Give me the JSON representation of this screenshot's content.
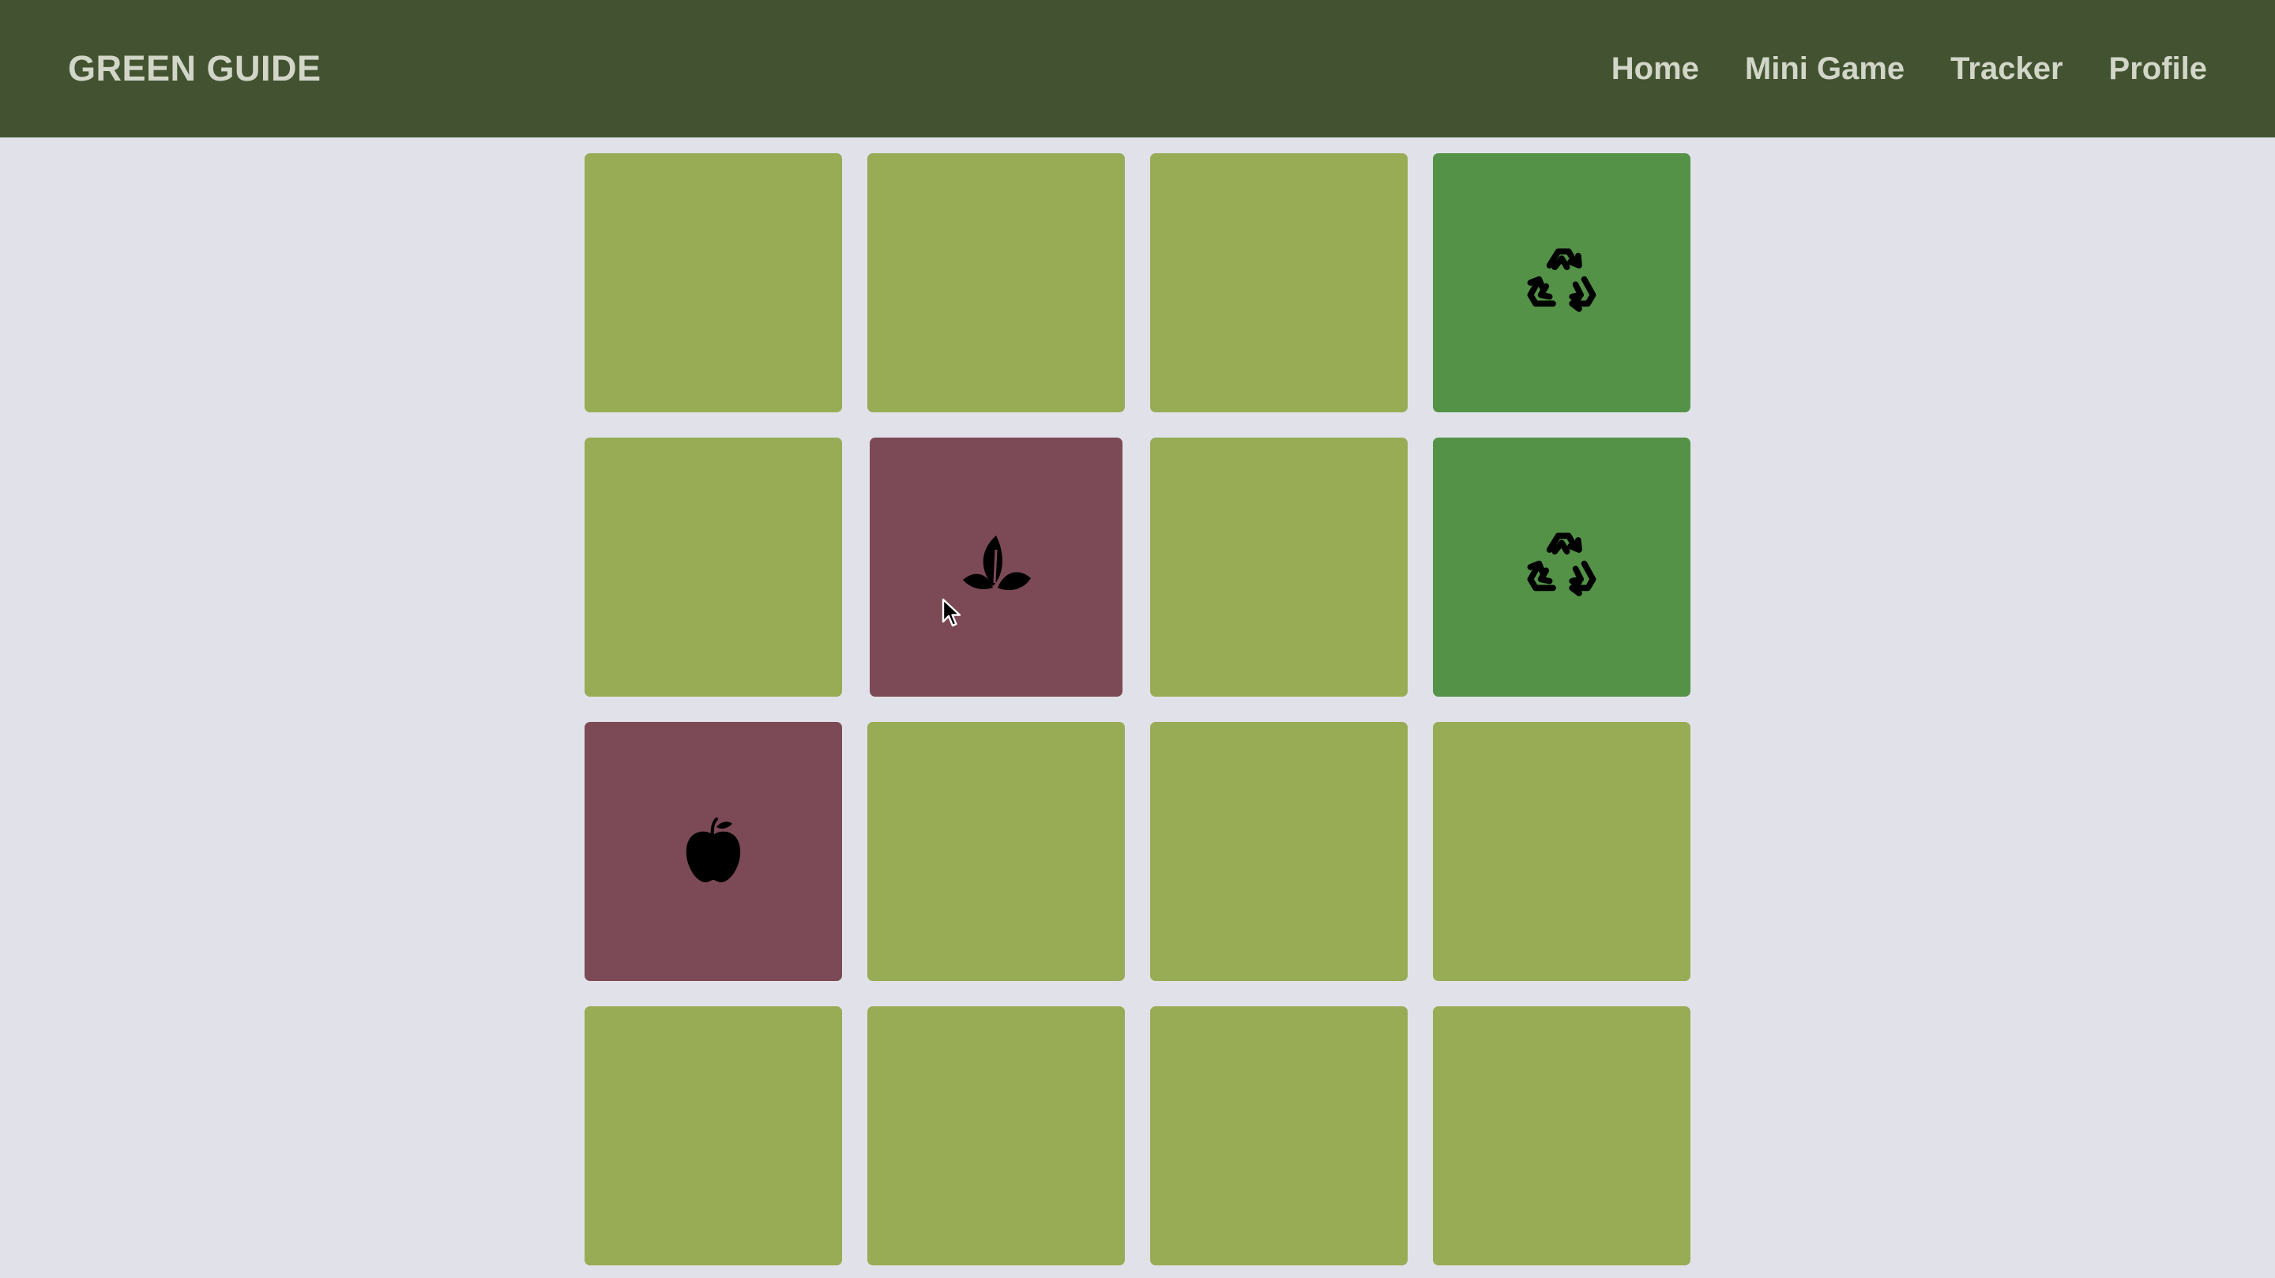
{
  "navbar": {
    "brand": "GREEN GUIDE",
    "links": [
      {
        "label": "Home"
      },
      {
        "label": "Mini Game"
      },
      {
        "label": "Tracker"
      },
      {
        "label": "Profile"
      }
    ]
  },
  "colors": {
    "navbar_bg": "#435331",
    "page_bg": "#e1e2e9",
    "card_hidden": "#98ab55",
    "card_matched": "#549248",
    "card_flipped": "#7c4a56"
  },
  "board": {
    "rows": 4,
    "cols": 4,
    "cards": [
      {
        "state": "hidden",
        "icon": null
      },
      {
        "state": "hidden",
        "icon": null
      },
      {
        "state": "hidden",
        "icon": null
      },
      {
        "state": "matched",
        "icon": "recycle-icon"
      },
      {
        "state": "hidden",
        "icon": null
      },
      {
        "state": "flipped",
        "icon": "leaves-icon"
      },
      {
        "state": "hidden",
        "icon": null
      },
      {
        "state": "matched",
        "icon": "recycle-icon"
      },
      {
        "state": "flipped",
        "icon": "apple-icon"
      },
      {
        "state": "hidden",
        "icon": null
      },
      {
        "state": "hidden",
        "icon": null
      },
      {
        "state": "hidden",
        "icon": null
      },
      {
        "state": "hidden",
        "icon": null
      },
      {
        "state": "hidden",
        "icon": null
      },
      {
        "state": "hidden",
        "icon": null
      },
      {
        "state": "hidden",
        "icon": null
      }
    ]
  }
}
